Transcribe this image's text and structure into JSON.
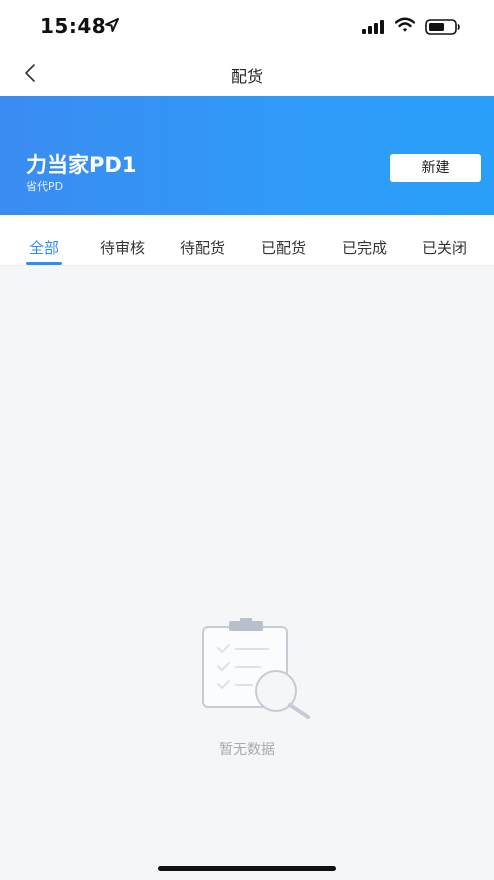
{
  "status_bar": {
    "time": "15:48"
  },
  "nav": {
    "title": "配货"
  },
  "banner": {
    "shop_name": "力当家PD1",
    "shop_type": "省代PD",
    "new_button": "新建"
  },
  "tabs": [
    {
      "label": "全部",
      "active": true
    },
    {
      "label": "待审核",
      "active": false
    },
    {
      "label": "待配货",
      "active": false
    },
    {
      "label": "已配货",
      "active": false
    },
    {
      "label": "已完成",
      "active": false
    },
    {
      "label": "已关闭",
      "active": false
    }
  ],
  "empty": {
    "text": "暂无数据",
    "icon": "clipboard-search-icon"
  },
  "colors": {
    "accent": "#2e8ef5",
    "banner": "#3b8cf0",
    "background": "#f5f6f8"
  }
}
